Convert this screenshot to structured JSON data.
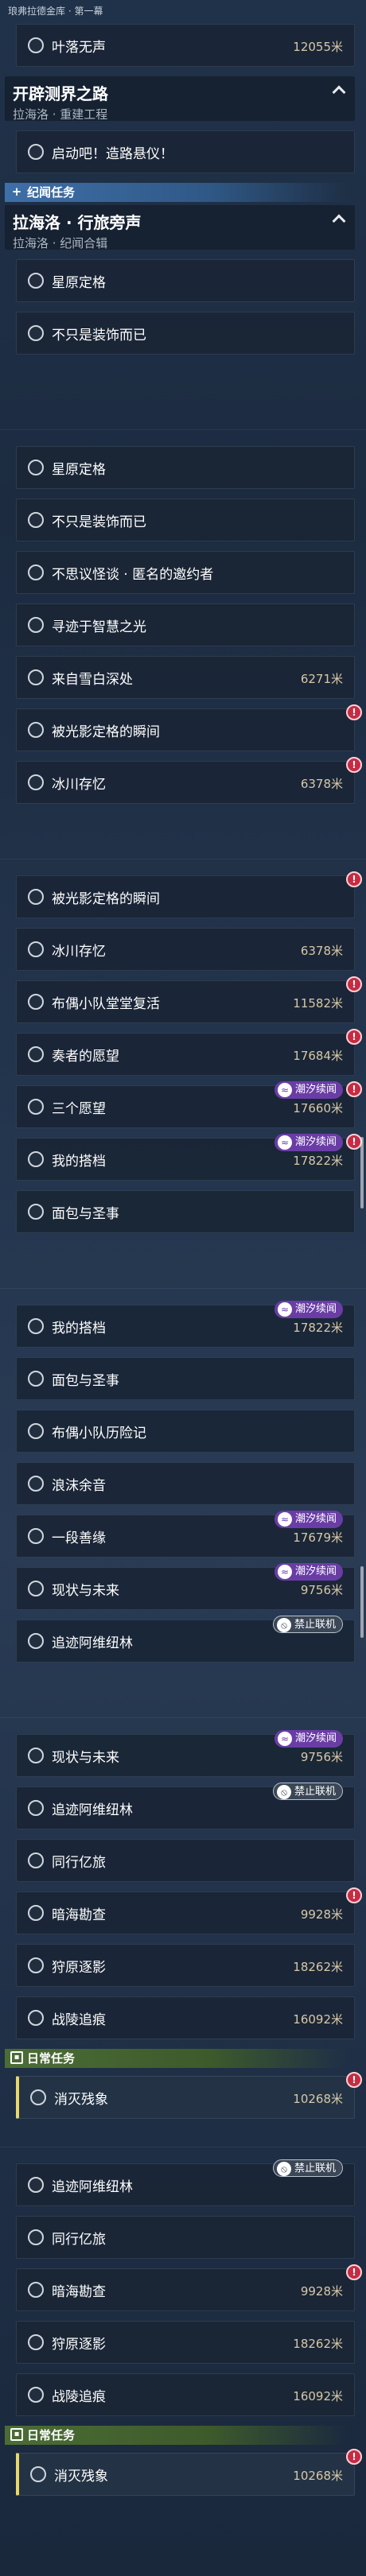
{
  "strips": [
    {
      "section_label": "琅弗拉德金库 · 第一幕",
      "items_a": [
        {
          "name": "叶落无声",
          "distance": "12055米",
          "selected": false
        }
      ],
      "group": {
        "title": "开辟测界之路",
        "subtitle": "拉海洛 · 重建工程"
      },
      "items_b": [
        {
          "name": "启动吧！造路悬仪！",
          "distance": "",
          "selected": false
        }
      ],
      "category": "纪闻任务",
      "group2": {
        "title": "拉海洛 · 行旅旁声",
        "subtitle": "拉海洛 · 纪闻合辑"
      },
      "items_c": [
        {
          "name": "星原定格",
          "distance": "",
          "selected": false
        },
        {
          "name": "不只是装饰而已",
          "distance": "",
          "selected": false
        }
      ]
    },
    {
      "items": [
        {
          "name": "星原定格",
          "distance": "",
          "selected": false
        },
        {
          "name": "不只是装饰而已",
          "distance": "",
          "selected": false
        },
        {
          "name": "不思议怪谈 · 匿名的邀约者",
          "distance": "",
          "selected": false
        },
        {
          "name": "寻迹于智慧之光",
          "distance": "",
          "selected": false
        },
        {
          "name": "来自雪白深处",
          "distance": "6271米",
          "selected": false
        },
        {
          "name": "被光影定格的瞬间",
          "distance": "",
          "selected": false,
          "alert": true
        },
        {
          "name": "冰川存忆",
          "distance": "6378米",
          "selected": false,
          "alert": true
        }
      ]
    },
    {
      "items": [
        {
          "name": "被光影定格的瞬间",
          "distance": "",
          "selected": false,
          "alert": true
        },
        {
          "name": "冰川存忆",
          "distance": "6378米",
          "selected": false
        },
        {
          "name": "布偶小队堂堂复活",
          "distance": "11582米",
          "selected": false,
          "alert": true
        },
        {
          "name": "奏者的愿望",
          "distance": "17684米",
          "selected": false,
          "alert": true
        },
        {
          "name": "三个愿望",
          "distance": "17660米",
          "selected": false,
          "alert": true,
          "badge": "潮汐续闻"
        },
        {
          "name": "我的搭档",
          "distance": "17822米",
          "selected": false,
          "alert": true,
          "badge": "潮汐续闻"
        },
        {
          "name": "面包与圣事",
          "distance": "",
          "selected": false
        }
      ]
    },
    {
      "items": [
        {
          "name": "我的搭档",
          "distance": "17822米",
          "selected": false,
          "badge": "潮汐续闻"
        },
        {
          "name": "面包与圣事",
          "distance": "",
          "selected": false
        },
        {
          "name": "布偶小队历险记",
          "distance": "",
          "selected": false
        },
        {
          "name": "浪沫余音",
          "distance": "",
          "selected": false
        },
        {
          "name": "一段善缘",
          "distance": "17679米",
          "selected": false,
          "badge": "潮汐续闻"
        },
        {
          "name": "现状与未来",
          "distance": "9756米",
          "selected": false,
          "badge": "潮汐续闻"
        },
        {
          "name": "追迹阿维纽林",
          "distance": "",
          "selected": false,
          "badge_ban": "禁止联机"
        }
      ]
    },
    {
      "items": [
        {
          "name": "现状与未来",
          "distance": "9756米",
          "selected": false,
          "badge": "潮汐续闻"
        },
        {
          "name": "追迹阿维纽林",
          "distance": "",
          "selected": false,
          "badge_ban": "禁止联机"
        },
        {
          "name": "同行亿旅",
          "distance": "",
          "selected": false
        },
        {
          "name": "暗海勘查",
          "distance": "9928米",
          "selected": false,
          "alert": true
        },
        {
          "name": "狩原逐影",
          "distance": "18262米",
          "selected": false
        },
        {
          "name": "战陵追痕",
          "distance": "16092米",
          "selected": false
        }
      ],
      "category": "日常任务",
      "tail_items": [
        {
          "name": "消灭残象",
          "distance": "10268米",
          "selected": true,
          "alert": true
        }
      ]
    },
    {
      "items": [
        {
          "name": "追迹阿维纽林",
          "distance": "",
          "selected": false,
          "badge_ban": "禁止联机"
        },
        {
          "name": "同行亿旅",
          "distance": "",
          "selected": false
        },
        {
          "name": "暗海勘查",
          "distance": "9928米",
          "selected": false,
          "alert": true
        },
        {
          "name": "狩原逐影",
          "distance": "18262米",
          "selected": false
        },
        {
          "name": "战陵追痕",
          "distance": "16092米",
          "selected": false
        }
      ],
      "category": "日常任务",
      "tail_items": [
        {
          "name": "消灭残象",
          "distance": "10268米",
          "selected": true,
          "alert": true
        }
      ]
    }
  ],
  "icons": {
    "radio": "radio-circle-icon",
    "alert": "exclamation-alert-icon",
    "tide": "tide-sequel-badge-icon",
    "ban": "no-coop-badge-icon",
    "chevron": "chevron-up-icon",
    "plus": "plus-category-icon",
    "daily": "daily-calendar-icon"
  },
  "colors": {
    "selected_accent": "#e8d76a",
    "alert": "#c52c43",
    "tide_badge": "#6a3da6",
    "category_blue": "#3f6fa8",
    "category_green": "#4b6d35",
    "distance_text": "#d7c8a8"
  }
}
